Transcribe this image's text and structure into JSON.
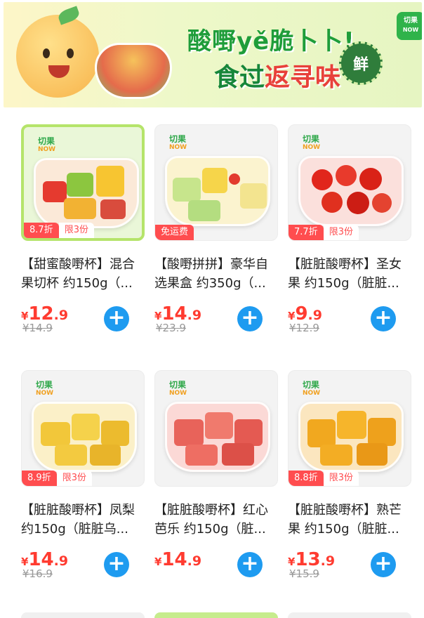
{
  "banner": {
    "title_line1": "酸嘢yě脆卜卜!",
    "title_line2_a": "食过",
    "title_line2_b": "返寻味",
    "seal_text": "鲜",
    "brand": "切果",
    "brand_sub": "NOW"
  },
  "products": [
    {
      "logo": "切果",
      "logo_sub": "NOW",
      "tag": "8.7折",
      "tag_sub": "限3份",
      "name": "【甜蜜酸嘢杯】混合果切杯 约150g（...",
      "price_sym": "¥",
      "price_int": "12",
      "price_dec": ".9",
      "orig": "¥14.9",
      "add": "+"
    },
    {
      "logo": "切果",
      "logo_sub": "NOW",
      "tag": "免运费",
      "tag_sub": "",
      "name": "【酸嘢拼拼】豪华自选果盒 约350g（...",
      "price_sym": "¥",
      "price_int": "14",
      "price_dec": ".9",
      "orig": "¥23.9",
      "add": "+"
    },
    {
      "logo": "切果",
      "logo_sub": "NOW",
      "tag": "7.7折",
      "tag_sub": "限3份",
      "name": "【脏脏酸嘢杯】圣女果 约150g（脏脏...",
      "price_sym": "¥",
      "price_int": "9",
      "price_dec": ".9",
      "orig": "¥12.9",
      "add": "+"
    },
    {
      "logo": "切果",
      "logo_sub": "NOW",
      "tag": "8.9折",
      "tag_sub": "限3份",
      "name": "【脏脏酸嘢杯】凤梨 约150g（脏脏乌...",
      "price_sym": "¥",
      "price_int": "14",
      "price_dec": ".9",
      "orig": "¥16.9",
      "add": "+"
    },
    {
      "logo": "切果",
      "logo_sub": "NOW",
      "tag": "",
      "tag_sub": "",
      "name": "【脏脏酸嘢杯】红心芭乐 约150g（脏...",
      "price_sym": "¥",
      "price_int": "14",
      "price_dec": ".9",
      "orig": "",
      "add": "+"
    },
    {
      "logo": "切果",
      "logo_sub": "NOW",
      "tag": "8.8折",
      "tag_sub": "限3份",
      "name": "【脏脏酸嘢杯】熟芒果 约150g（脏脏...",
      "price_sym": "¥",
      "price_int": "13",
      "price_dec": ".9",
      "orig": "¥15.9",
      "add": "+"
    }
  ]
}
